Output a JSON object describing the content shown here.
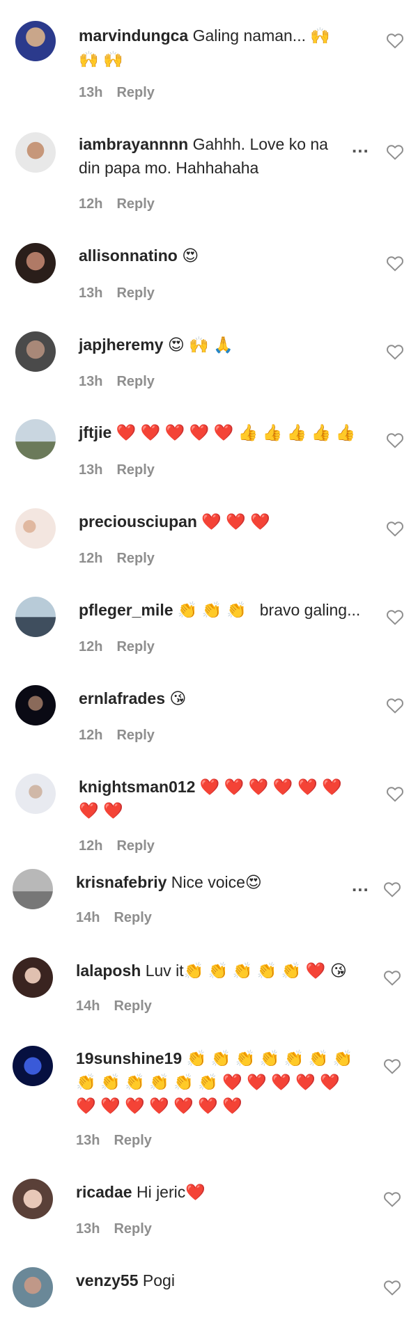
{
  "comments": [
    {
      "username": "marvindungca",
      "text": " Galing naman... 🙌\n🙌 🙌",
      "time": "13h",
      "reply": "Reply"
    },
    {
      "username": "iambrayannnn",
      "text": " Gahhh. Love ko na\ndin papa mo. Hahhahaha",
      "time": "12h",
      "reply": "Reply",
      "more": "..."
    },
    {
      "username": "allisonnatino",
      "text": " 😍",
      "time": "13h",
      "reply": "Reply"
    },
    {
      "username": "japjheremy",
      "text": " 😍 🙌 🙏",
      "time": "13h",
      "reply": "Reply"
    },
    {
      "username": "jftjie",
      "text": " ❤️ ❤️ ❤️ ❤️ ❤️ 👍 👍 👍 👍 👍",
      "time": "13h",
      "reply": "Reply"
    },
    {
      "username": "preciousciupan",
      "text": " ❤️ ❤️ ❤️",
      "time": "12h",
      "reply": "Reply"
    },
    {
      "username": "pfleger_mile",
      "text": " 👏 👏 👏   bravo galing...",
      "time": "12h",
      "reply": "Reply"
    },
    {
      "username": "ernlafrades",
      "text": " 😘",
      "time": "12h",
      "reply": "Reply"
    },
    {
      "username": "knightsman012",
      "text": " ❤️ ❤️ ❤️ ❤️ ❤️ ❤️\n❤️ ❤️",
      "time": "12h",
      "reply": "Reply"
    },
    {
      "username": "krisnafebriy",
      "text": " Nice voice😍",
      "time": "14h",
      "reply": "Reply",
      "more": "..."
    },
    {
      "username": "lalaposh",
      "text": " Luv it👏 👏 👏 👏 👏 ❤️ 😘",
      "time": "14h",
      "reply": "Reply"
    },
    {
      "username": "19sunshine19",
      "text": " 👏 👏 👏 👏 👏 👏 👏\n👏 👏 👏 👏 👏 👏 ❤️ ❤️ ❤️ ❤️ ❤️\n❤️ ❤️ ❤️ ❤️ ❤️ ❤️ ❤️",
      "time": "13h",
      "reply": "Reply"
    },
    {
      "username": "ricadae",
      "text": " Hi jeric❤️",
      "time": "13h",
      "reply": "Reply"
    },
    {
      "username": "venzy55",
      "text": " Pogi"
    }
  ],
  "colors": {
    "text": "#262626",
    "meta": "#8e8e8e",
    "heart_outline": "#8e8e8e"
  },
  "icons": {
    "like": "heart-outline-icon",
    "more": "more-options-icon"
  }
}
